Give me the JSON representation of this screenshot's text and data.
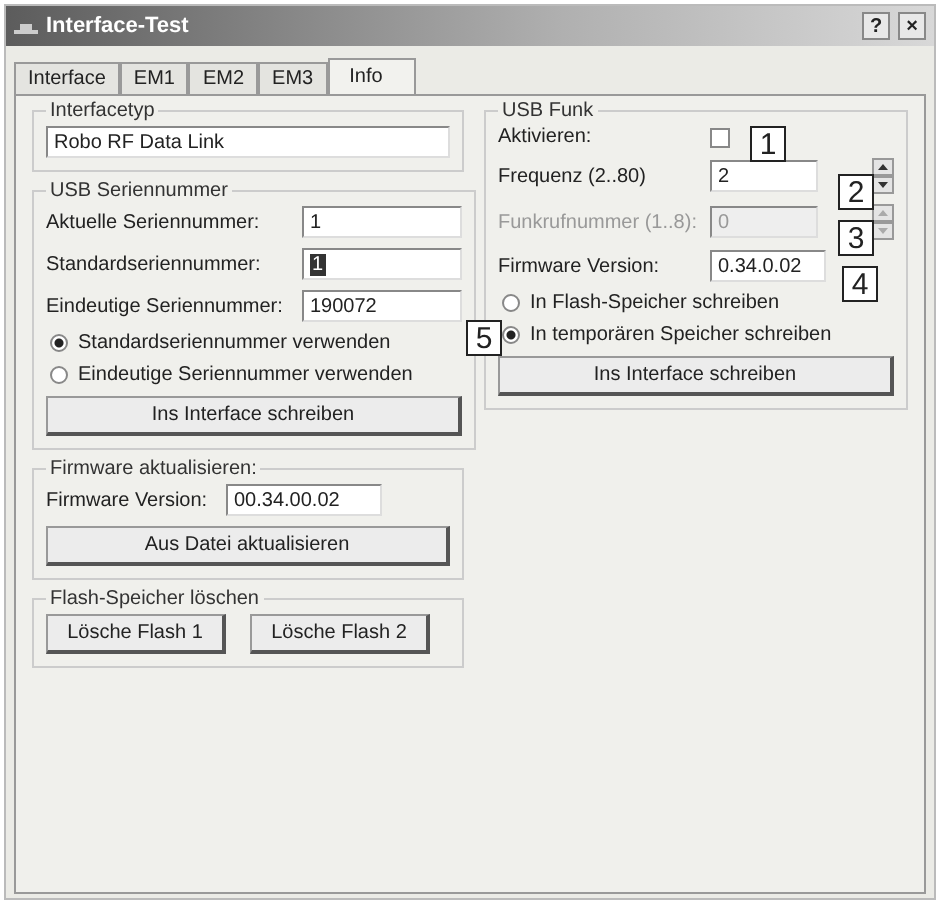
{
  "window": {
    "title": "Interface-Test",
    "help_button": "?",
    "close_button": "×"
  },
  "tabs": [
    {
      "label": "Interface",
      "selected": false
    },
    {
      "label": "EM1",
      "selected": false
    },
    {
      "label": "EM2",
      "selected": false
    },
    {
      "label": "EM3",
      "selected": false
    },
    {
      "label": "Info",
      "selected": true
    }
  ],
  "interface_type": {
    "title": "Interfacetyp",
    "value": "Robo RF Data Link"
  },
  "usb_serial": {
    "title": "USB Seriennummer",
    "fields": [
      {
        "label": "Aktuelle Seriennummer:",
        "value": "1",
        "text_selected": false
      },
      {
        "label": "Standardseriennummer:",
        "value": "1",
        "text_selected": true
      },
      {
        "label": "Eindeutige Seriennummer:",
        "value": "190072",
        "text_selected": false
      }
    ],
    "radios": [
      {
        "label": "Standardseriennummer verwenden",
        "selected": true
      },
      {
        "label": "Eindeutige Seriennummer verwenden",
        "selected": false
      }
    ],
    "button": "Ins Interface schreiben"
  },
  "firmware_update": {
    "title": "Firmware aktualisieren:",
    "label": "Firmware Version:",
    "value": "00.34.00.02",
    "button": "Aus Datei aktualisieren"
  },
  "flash_delete": {
    "title": "Flash-Speicher löschen",
    "buttons": [
      "Lösche Flash 1",
      "Lösche Flash 2"
    ]
  },
  "usb_radio": {
    "title": "USB Funk",
    "rows": [
      {
        "kind": "checkbox",
        "label": "Aktivieren:",
        "checked": false
      },
      {
        "kind": "spin",
        "label": "Frequenz (2..80)",
        "value": "2",
        "disabled": false
      },
      {
        "kind": "spin",
        "label": "Funkrufnummer (1..8):",
        "value": "0",
        "disabled": true
      },
      {
        "kind": "text",
        "label": "Firmware Version:",
        "value": "0.34.0.02"
      }
    ],
    "radios": [
      {
        "label": "In Flash-Speicher schreiben",
        "selected": false
      },
      {
        "label": "In temporären Speicher schreiben",
        "selected": true
      }
    ],
    "button": "Ins Interface schreiben"
  },
  "callouts": [
    "1",
    "2",
    "3",
    "4",
    "5"
  ]
}
